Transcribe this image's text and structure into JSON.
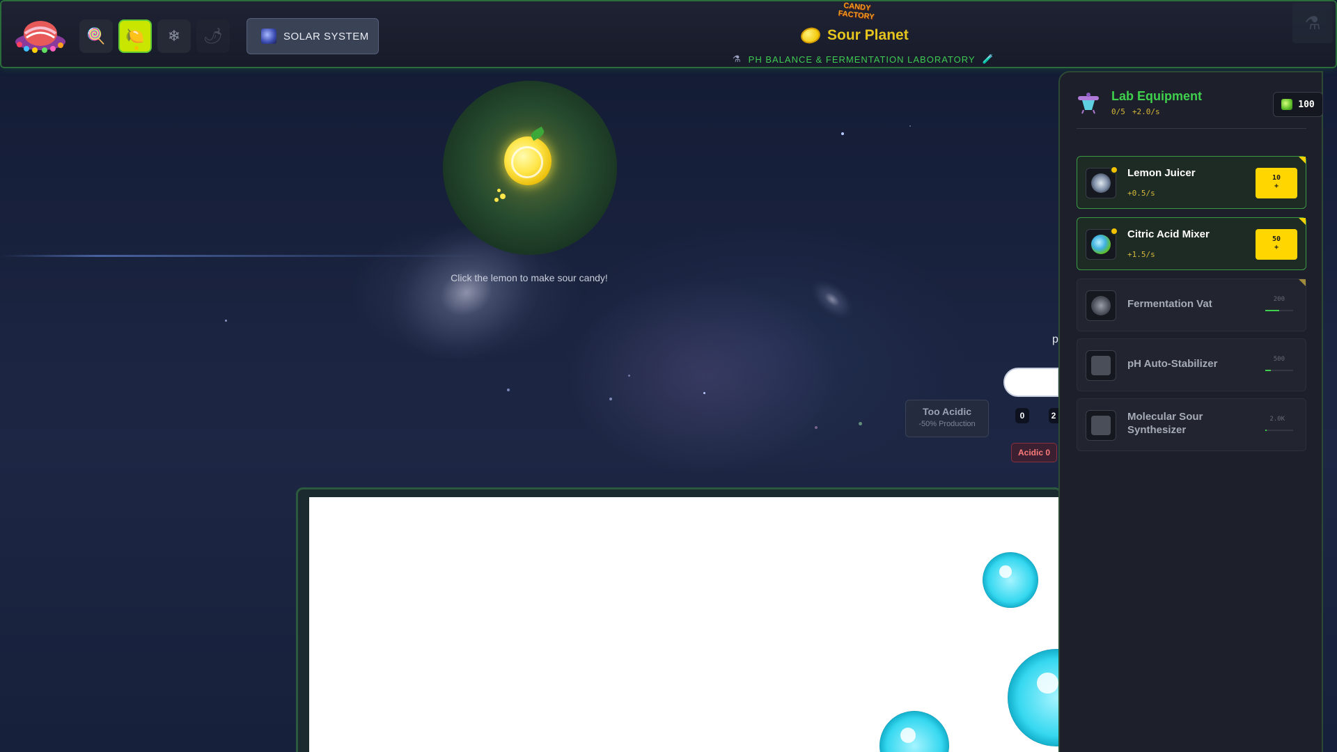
{
  "topbar": {
    "brand": "CANDY FACTORY",
    "nav": [
      {
        "name": "lollipop",
        "glyph": "🍭"
      },
      {
        "name": "lemon",
        "glyph": "🍋"
      },
      {
        "name": "snowflake",
        "glyph": "❄"
      },
      {
        "name": "chili",
        "glyph": "🌶"
      }
    ],
    "solar_button": "SOLAR SYSTEM",
    "planet_title": "Sour Planet",
    "lab_subtitle": "PH BALANCE & FERMENTATION LABORATORY"
  },
  "clicker": {
    "hint": "Click the lemon to make sour candy!"
  },
  "ph": {
    "label_partial": "p",
    "too_acidic_title": "Too Acidic",
    "too_acidic_effect": "-50% Production",
    "tick_0": "0",
    "tick_partial": "2",
    "acidic_badge": "Acidic 0"
  },
  "lab": {
    "title": "Lab Equipment",
    "capacity": "0/5",
    "rate": "+2.0/s",
    "currency": "100",
    "items": [
      {
        "name": "Lemon Juicer",
        "rate": "+0.5/s",
        "cost": "10",
        "plus": "+"
      },
      {
        "name": "Citric Acid Mixer",
        "rate": "+1.5/s",
        "cost": "50",
        "plus": "+"
      },
      {
        "name": "Fermentation Vat",
        "cost": "200",
        "progress": 0.5
      },
      {
        "name": "pH Auto-Stabilizer",
        "cost": "500",
        "progress": 0.2
      },
      {
        "name": "Molecular Sour Synthesizer",
        "cost": "2.0K",
        "progress": 0.05
      }
    ]
  },
  "colors": {
    "accent_green": "#3fd04d",
    "accent_yellow": "#ffd600",
    "title_gold": "#e6c41e",
    "danger": "#ff7b7b"
  }
}
